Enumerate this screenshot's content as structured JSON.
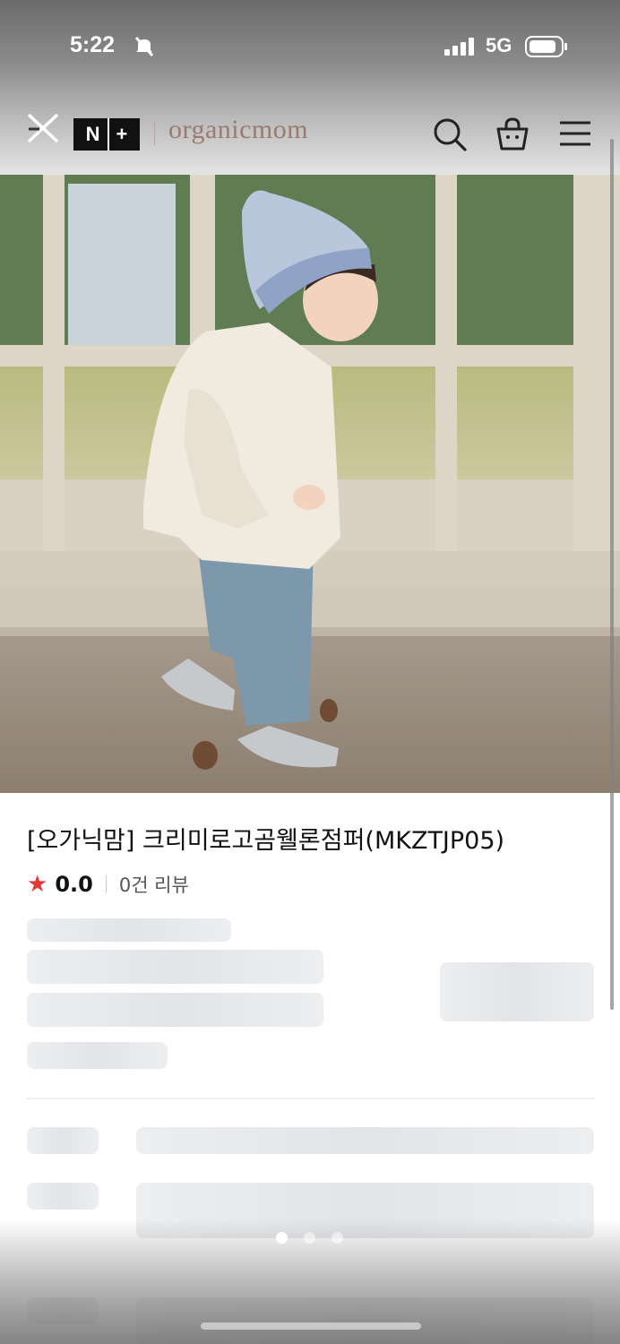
{
  "status_bar": {
    "time": "5:22",
    "network": "5G"
  },
  "header": {
    "brand": "organicmom",
    "badge_left": "N",
    "badge_right": "+"
  },
  "product": {
    "title": "[오가닉맘] 크리미로고곰웰론점퍼(MKZTJP05)",
    "rating": "0.0",
    "reviews": "0건 리뷰"
  },
  "carousel": {
    "page_count": 3,
    "active_index": 0
  },
  "colors": {
    "brand": "#9a7a6e",
    "star": "#e53935",
    "skeleton": "#e6e8eb"
  },
  "icons": [
    "close-icon",
    "search-icon",
    "cart-icon",
    "menu-icon",
    "star-icon",
    "signal-icon",
    "battery-icon",
    "bell-slash-icon"
  ]
}
